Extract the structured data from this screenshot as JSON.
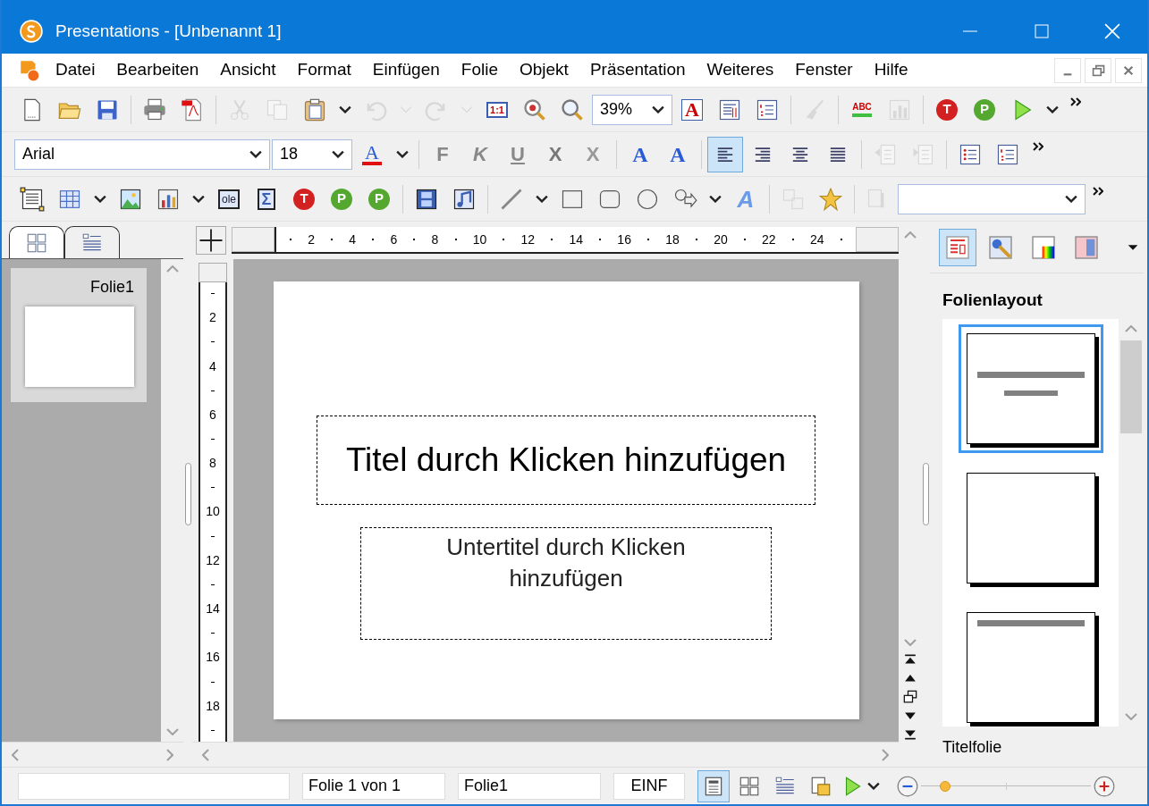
{
  "window": {
    "title": "Presentations - [Unbenannt 1]"
  },
  "menu": [
    "Datei",
    "Bearbeiten",
    "Ansicht",
    "Format",
    "Einfügen",
    "Folie",
    "Objekt",
    "Präsentation",
    "Weiteres",
    "Fenster",
    "Hilfe"
  ],
  "toolbars": [
    [
      [
        {
          "kind": "new",
          "disabled": false
        },
        {
          "kind": "open",
          "disabled": false
        },
        {
          "kind": "save",
          "disabled": false
        }
      ],
      [
        {
          "kind": "print",
          "disabled": false
        },
        {
          "kind": "pdf",
          "disabled": false
        }
      ],
      [
        {
          "kind": "cut",
          "disabled": true
        },
        {
          "kind": "copy",
          "disabled": true
        },
        {
          "kind": "paste",
          "disabled": false
        },
        {
          "kind": "dropdown",
          "disabled": false
        },
        {
          "kind": "undo",
          "disabled": true
        },
        {
          "kind": "dropdown",
          "disabled": true
        },
        {
          "kind": "redo",
          "disabled": true
        },
        {
          "kind": "dropdown",
          "disabled": true
        },
        {
          "kind": "zoom100",
          "label": "1:1",
          "disabled": false
        },
        {
          "kind": "zoomfit",
          "disabled": false
        },
        {
          "kind": "zoom",
          "disabled": false
        },
        {
          "kind": "combo",
          "value": "39%",
          "disabled": false
        },
        {
          "kind": "charfmt",
          "label": "A",
          "disabled": false
        },
        {
          "kind": "paraformat",
          "disabled": false
        },
        {
          "kind": "numbering",
          "disabled": false
        }
      ],
      [
        {
          "kind": "brush",
          "disabled": true
        }
      ],
      [
        {
          "kind": "spell",
          "label": "ABC",
          "disabled": false
        },
        {
          "kind": "chart",
          "disabled": true
        }
      ],
      [
        {
          "kind": "round-t",
          "label": "T",
          "disabled": false
        },
        {
          "kind": "round-p",
          "label": "P",
          "disabled": false
        },
        {
          "kind": "play",
          "disabled": false
        },
        {
          "kind": "dropdown",
          "disabled": false
        },
        {
          "kind": "overflow",
          "disabled": false
        }
      ]
    ],
    [
      [
        {
          "kind": "combo-wide",
          "value": "Arial",
          "disabled": false
        },
        {
          "kind": "combo",
          "value": "18",
          "disabled": false
        },
        {
          "kind": "fontcolor",
          "label": "A",
          "disabled": false
        },
        {
          "kind": "dropdown",
          "disabled": false
        }
      ],
      [
        {
          "kind": "bold",
          "label": "F",
          "disabled": false
        },
        {
          "kind": "italic",
          "label": "K",
          "disabled": false
        },
        {
          "kind": "underline",
          "label": "U",
          "disabled": false
        },
        {
          "kind": "strike",
          "label": "X",
          "disabled": false
        },
        {
          "kind": "xstrike",
          "label": "X",
          "disabled": false
        }
      ],
      [
        {
          "kind": "grow",
          "label": "A",
          "disabled": false
        },
        {
          "kind": "shrink",
          "label": "A",
          "disabled": false
        }
      ],
      [
        {
          "kind": "alignleft",
          "disabled": false,
          "selected": true
        },
        {
          "kind": "alignright",
          "disabled": false,
          "selected": false
        },
        {
          "kind": "aligncenter",
          "disabled": false,
          "selected": false
        },
        {
          "kind": "justify",
          "disabled": false,
          "selected": false
        }
      ],
      [
        {
          "kind": "outdent",
          "disabled": true
        },
        {
          "kind": "indent",
          "disabled": true
        }
      ],
      [
        {
          "kind": "bullets",
          "disabled": false
        },
        {
          "kind": "numbering",
          "disabled": false
        },
        {
          "kind": "overflow",
          "disabled": false
        }
      ]
    ],
    [
      [
        {
          "kind": "textframe",
          "disabled": false
        },
        {
          "kind": "table",
          "disabled": false
        },
        {
          "kind": "dropdown",
          "disabled": false
        },
        {
          "kind": "picture",
          "disabled": false
        },
        {
          "kind": "chart",
          "disabled": false
        },
        {
          "kind": "dropdown",
          "disabled": false
        },
        {
          "kind": "ole",
          "label": "ole",
          "disabled": false
        },
        {
          "kind": "formula",
          "label": "Σ",
          "disabled": false
        },
        {
          "kind": "round-t",
          "label": "T",
          "disabled": false
        },
        {
          "kind": "round-p",
          "label": "P",
          "disabled": false
        },
        {
          "kind": "round-p",
          "label": "P",
          "disabled": false
        }
      ],
      [
        {
          "kind": "video",
          "disabled": false
        },
        {
          "kind": "audio",
          "disabled": false
        }
      ],
      [
        {
          "kind": "line",
          "disabled": false
        },
        {
          "kind": "dropdown",
          "disabled": false
        },
        {
          "kind": "rect",
          "disabled": false
        },
        {
          "kind": "rounded",
          "disabled": false
        },
        {
          "kind": "ellipse",
          "disabled": false
        },
        {
          "kind": "shapes",
          "disabled": false
        },
        {
          "kind": "dropdown",
          "disabled": false
        },
        {
          "kind": "textart",
          "label": "A",
          "disabled": false
        }
      ],
      [
        {
          "kind": "group",
          "disabled": true
        },
        {
          "kind": "star",
          "disabled": false
        }
      ],
      [
        {
          "kind": "tools",
          "disabled": true
        },
        {
          "kind": "combo-mid",
          "disabled": false
        },
        {
          "kind": "overflow",
          "disabled": false
        }
      ]
    ]
  ],
  "left_panel": {
    "tabs": [
      {
        "kind": "slides",
        "selected": true
      },
      {
        "kind": "outline",
        "selected": false
      }
    ],
    "slides": [
      {
        "label": "Folie1",
        "selected": true
      }
    ]
  },
  "rulers": {
    "horizontal": [
      "2",
      "4",
      "6",
      "8",
      "10",
      "12",
      "14",
      "16",
      "18",
      "20",
      "22",
      "24"
    ],
    "vertical": [
      "2",
      "4",
      "6",
      "8",
      "10",
      "12",
      "14",
      "16",
      "18"
    ]
  },
  "slide": {
    "title": "Titel durch Klicken hinzufügen",
    "subtitle": "Untertitel durch Klicken hinzufügen"
  },
  "sidebar": {
    "tabs": [
      {
        "kind": "layout",
        "selected": true
      },
      {
        "kind": "design",
        "selected": false
      },
      {
        "kind": "colors",
        "selected": false
      },
      {
        "kind": "background",
        "selected": false
      }
    ],
    "heading": "Folienlayout",
    "layouts": [
      {
        "kind": "title",
        "selected": true
      },
      {
        "kind": "blank",
        "selected": false
      },
      {
        "kind": "title-only",
        "selected": false
      }
    ],
    "caption": "Titelfolie"
  },
  "status_bar": {
    "fields": [
      "Folie 1 von 1",
      "Folie1",
      "EINF"
    ],
    "views": [
      {
        "kind": "normal",
        "selected": true
      },
      {
        "kind": "sorter",
        "selected": false
      },
      {
        "kind": "outline",
        "selected": false
      },
      {
        "kind": "handout",
        "selected": false
      }
    ],
    "zoom": {
      "level": 0.14
    }
  }
}
